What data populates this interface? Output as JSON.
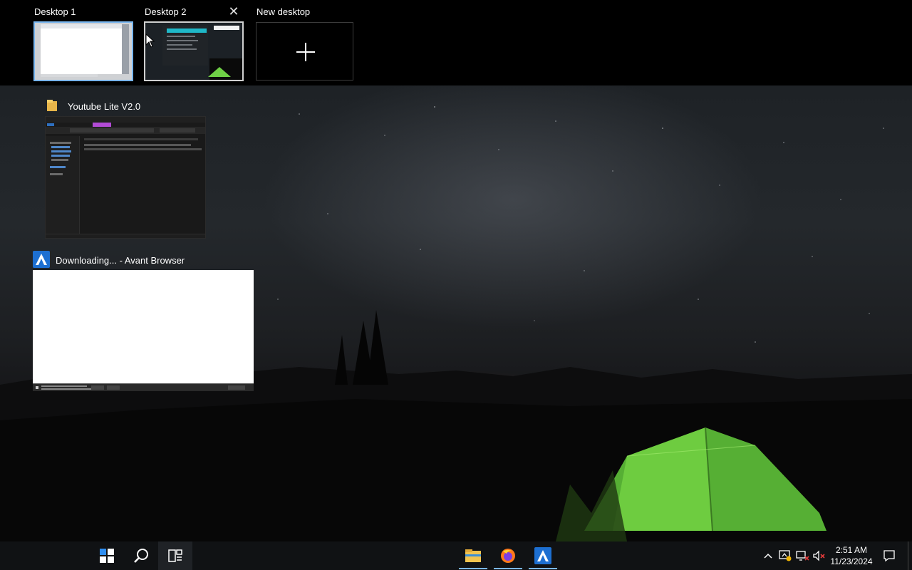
{
  "desktops": [
    {
      "label": "Desktop 1",
      "state": "current"
    },
    {
      "label": "Desktop 2",
      "state": "hover"
    }
  ],
  "new_desktop": {
    "label": "New desktop"
  },
  "windows": [
    {
      "title": "Youtube Lite V2.0",
      "app": "File Explorer"
    },
    {
      "title": "Downloading... - Avant Browser",
      "app": "Avant Browser"
    }
  ],
  "taskbar": {
    "pinned": [
      "start-icon",
      "search-icon",
      "task-view-icon",
      "file-explorer-icon",
      "firefox-icon",
      "avant-browser-icon"
    ],
    "clock": {
      "time": "2:51 AM",
      "date": "11/23/2024"
    },
    "tray": [
      "chevron-up-icon",
      "update-warning-icon",
      "network-disconnected-icon",
      "volume-muted-icon",
      "notification-icon"
    ]
  },
  "colors": {
    "accent": "#7ab7f0",
    "taskbar": "#101214"
  }
}
